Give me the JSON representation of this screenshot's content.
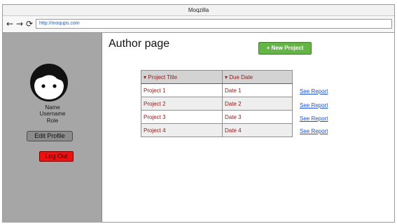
{
  "window": {
    "title": "Moqzilla"
  },
  "browser": {
    "back_icon": "←",
    "forward_icon": "→",
    "reload_icon": "⟳",
    "url": "http://moqups.com"
  },
  "sidebar": {
    "avatar_icon": "face-icon",
    "name": "Name",
    "username": "Username",
    "role": "Role",
    "edit_profile_label": "Edit Profile",
    "logout_label": "Log Out"
  },
  "main": {
    "title": "Author page",
    "new_project_label": "+ New Project",
    "table": {
      "headers": [
        "▾ Project Title",
        "▾ Due Date"
      ],
      "rows": [
        {
          "title": "Project 1",
          "date": "Date 1",
          "report": "See Report"
        },
        {
          "title": "Project 2",
          "date": "Date 2",
          "report": "See Report"
        },
        {
          "title": "Project 3",
          "date": "Date 3",
          "report": "See Report"
        },
        {
          "title": "Project 4",
          "date": "Date 4",
          "report": "See Report"
        }
      ]
    }
  },
  "colors": {
    "sidebar_bg": "#a6a6a6",
    "accent_green": "#64b446",
    "logout_red": "#ee1111",
    "table_text": "#8a1b1b",
    "link_blue": "#1a4fd6"
  }
}
